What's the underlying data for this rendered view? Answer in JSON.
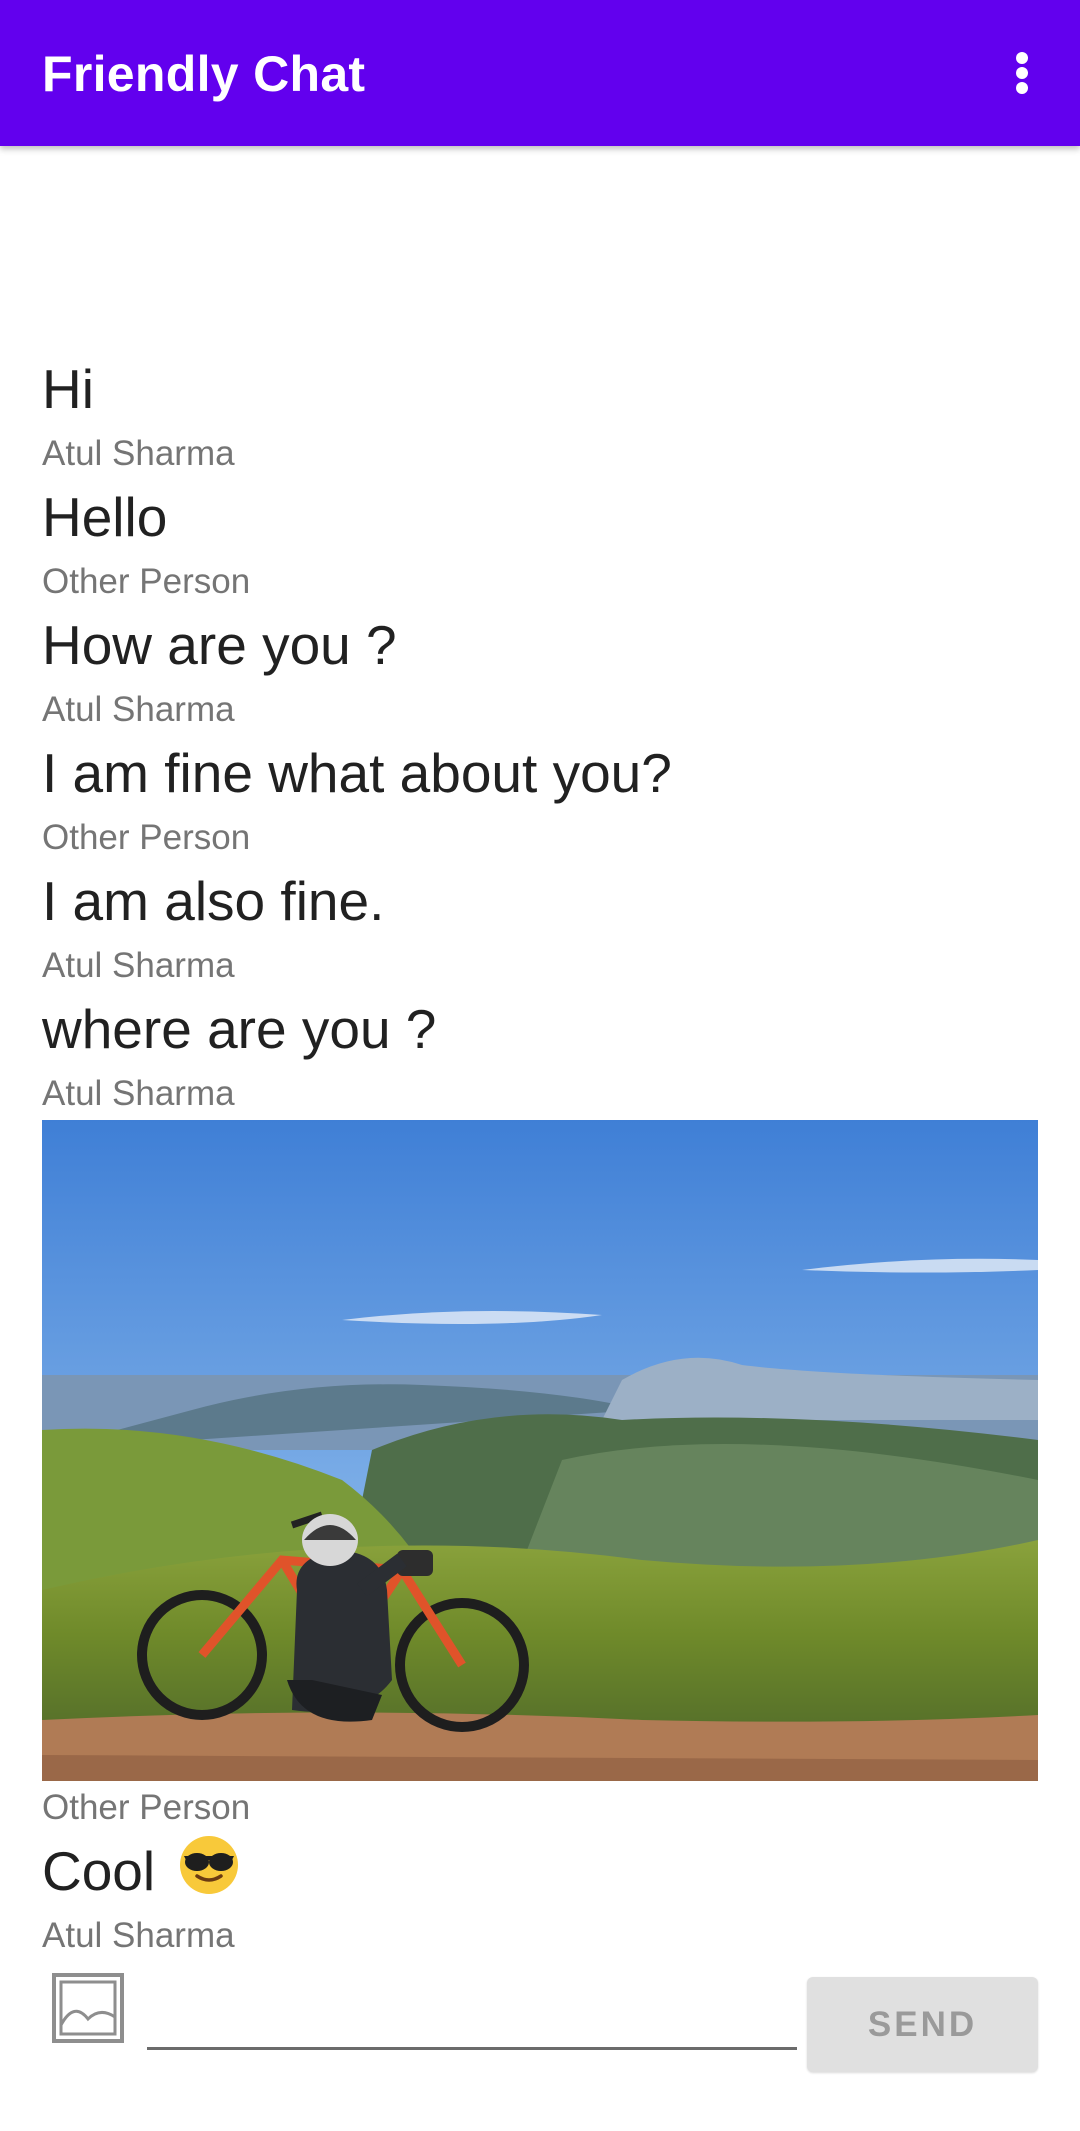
{
  "app_bar": {
    "title": "Friendly Chat",
    "overflow_icon": "more-vert-icon",
    "color": "#6200ee"
  },
  "messages": [
    {
      "type": "text",
      "text": "Hi",
      "author": "Atul Sharma"
    },
    {
      "type": "text",
      "text": "Hello",
      "author": "Other Person"
    },
    {
      "type": "text",
      "text": "How are you ?",
      "author": "Atul Sharma"
    },
    {
      "type": "text",
      "text": "I am fine what about you?",
      "author": "Other Person"
    },
    {
      "type": "text",
      "text": "I am also fine.",
      "author": "Atul Sharma"
    },
    {
      "type": "text",
      "text": "where are you ?",
      "author": "Atul Sharma"
    },
    {
      "type": "image",
      "image": "mountain-bike-landscape-photo",
      "author": "Other Person"
    },
    {
      "type": "text",
      "text": "Cool",
      "emoji": "smiling-face-with-sunglasses",
      "author": "Atul Sharma"
    }
  ],
  "composer": {
    "image_button_icon": "image-placeholder-icon",
    "input_value": "",
    "input_placeholder": "",
    "send_label": "SEND"
  }
}
